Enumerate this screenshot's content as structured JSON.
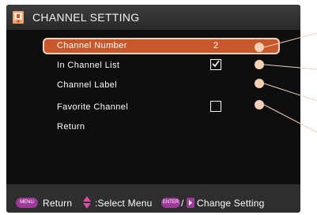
{
  "title": "CHANNEL SETTING",
  "items": [
    {
      "label": "Channel Number",
      "value": "2"
    },
    {
      "label": "In Channel List",
      "checked": true
    },
    {
      "label": "Channel Label"
    },
    {
      "label": "Favorite Channel",
      "checked": false
    },
    {
      "label": "Return"
    }
  ],
  "status": {
    "menu_key": "MENU",
    "return": "Return",
    "select": ":Select Menu",
    "enter_key": "ENTER",
    "slash": "/",
    "change": "Change Setting"
  },
  "colors": {
    "highlight": "#c8582b",
    "key": "#a03a9a",
    "callout": "#f3d0b6"
  }
}
